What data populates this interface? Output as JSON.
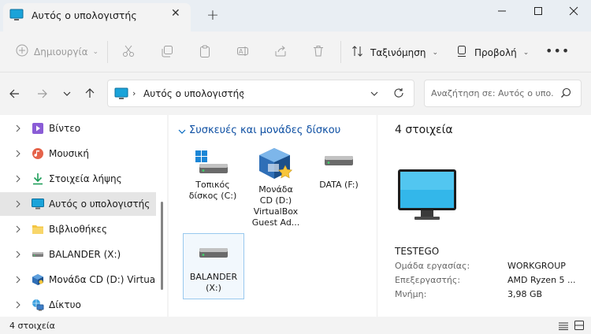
{
  "window": {
    "tab_title": "Αυτός ο υπολογιστής"
  },
  "toolbar": {
    "new_label": "Δημιουργία",
    "sort_label": "Ταξινόμηση",
    "view_label": "Προβολή"
  },
  "address": {
    "path": "Αυτός ο υπολογιστής",
    "search_placeholder": "Αναζήτηση σε: Αυτός ο υπο..."
  },
  "nav": {
    "items": [
      {
        "label": "Βίντεο",
        "icon": "video-icon"
      },
      {
        "label": "Μουσική",
        "icon": "music-icon"
      },
      {
        "label": "Στοιχεία λήψης",
        "icon": "downloads-icon"
      },
      {
        "label": "Αυτός ο υπολογιστής",
        "icon": "computer-icon",
        "selected": true
      },
      {
        "label": "Βιβλιοθήκες",
        "icon": "folder-icon"
      },
      {
        "label": "BALANDER (X:)",
        "icon": "drive-icon"
      },
      {
        "label": "Μονάδα CD (D:) VirtualBo",
        "icon": "virtualbox-icon"
      },
      {
        "label": "Δίκτυο",
        "icon": "network-icon"
      }
    ]
  },
  "content": {
    "group_title": "Συσκευές και μονάδες δίσκου",
    "drives": [
      {
        "label_lines": [
          "Τοπικός",
          "δίσκος (C:)"
        ],
        "icon": "windows-drive-icon"
      },
      {
        "label_lines": [
          "Μονάδα",
          "CD (D:)",
          "VirtualBox",
          "Guest Ad..."
        ],
        "icon": "virtualbox-cd-icon"
      },
      {
        "label_lines": [
          "DATA (F:)"
        ],
        "icon": "drive-icon"
      },
      {
        "label_lines": [
          "BALANDER",
          "(X:)"
        ],
        "icon": "drive-icon",
        "selected": true
      }
    ]
  },
  "details": {
    "count_title": "4 στοιχεία",
    "computer_name": "TESTEGO",
    "rows": [
      {
        "key": "Ομάδα εργασίας:",
        "value": "WORKGROUP"
      },
      {
        "key": "Επεξεργαστής:",
        "value": "AMD Ryzen 5 ..."
      },
      {
        "key": "Μνήμη:",
        "value": "3,98 GB"
      }
    ]
  },
  "status": {
    "count": "4 στοιχεία"
  },
  "colors": {
    "accent": "#0067c0",
    "title_bg": "#e9eef3"
  }
}
